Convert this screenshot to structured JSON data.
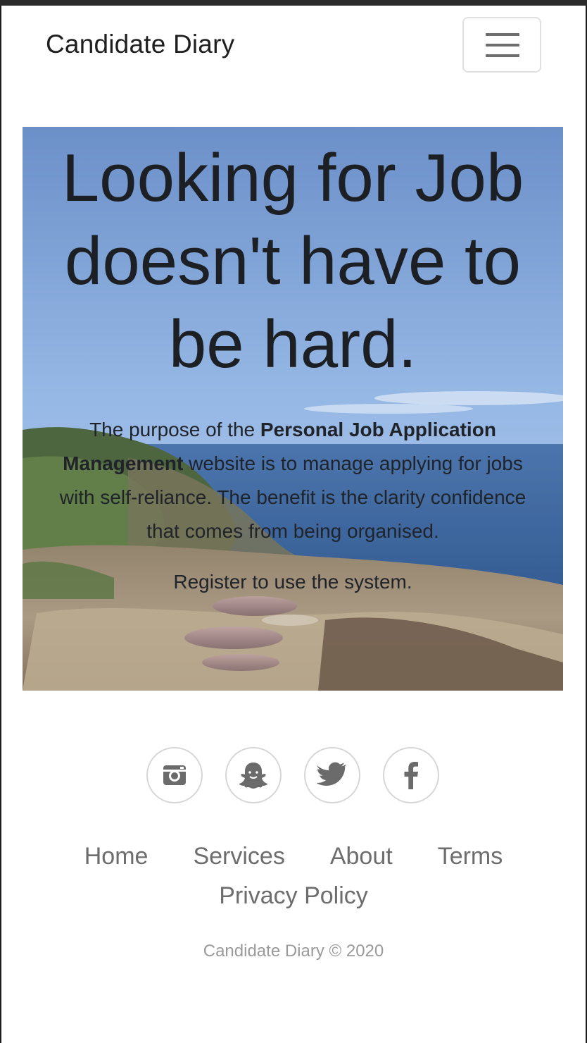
{
  "navbar": {
    "brand": "Candidate Diary",
    "menu_icon": "hamburger-menu-icon"
  },
  "hero": {
    "title": "Looking for Job doesn't have to be hard.",
    "text_before": "The purpose of the ",
    "text_bold": "Personal Job Application Management",
    "text_after": " website is to manage applying for jobs with self-reliance. The benefit is the clarity confidence that comes from being organised.",
    "register_text": "Register to use the system.",
    "background_image": "coastal-cliff-ocean-photo"
  },
  "socials": [
    {
      "icon": "instagram-icon"
    },
    {
      "icon": "snapchat-icon"
    },
    {
      "icon": "twitter-icon"
    },
    {
      "icon": "facebook-icon"
    }
  ],
  "footer": {
    "links": [
      "Home",
      "Services",
      "About",
      "Terms",
      "Privacy Policy"
    ],
    "copyright": "Candidate Diary © 2020"
  },
  "colors": {
    "text_dark": "#1c1f23",
    "footer_link": "#6d6d6d",
    "copyright": "#9a9a9a",
    "icon": "#6b6b6b"
  }
}
